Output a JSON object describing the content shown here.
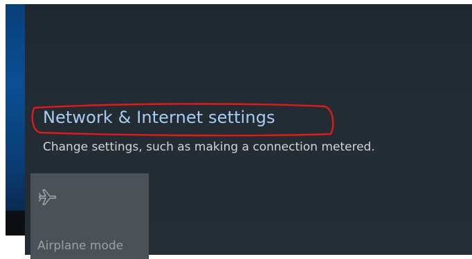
{
  "action_center": {
    "network_link_label": "Network & Internet settings",
    "network_description": "Change settings, such as making a connection metered.",
    "quick_action_tile": {
      "label": "Airplane mode",
      "icon": "airplane-icon"
    }
  },
  "colors": {
    "panel_background": "#232b33",
    "link_text": "#a9cdf2",
    "description_text": "#d2d6da",
    "tile_background": "#4a5157",
    "annotation": "#e01b1b",
    "desktop_accent": "#0b4f93"
  }
}
